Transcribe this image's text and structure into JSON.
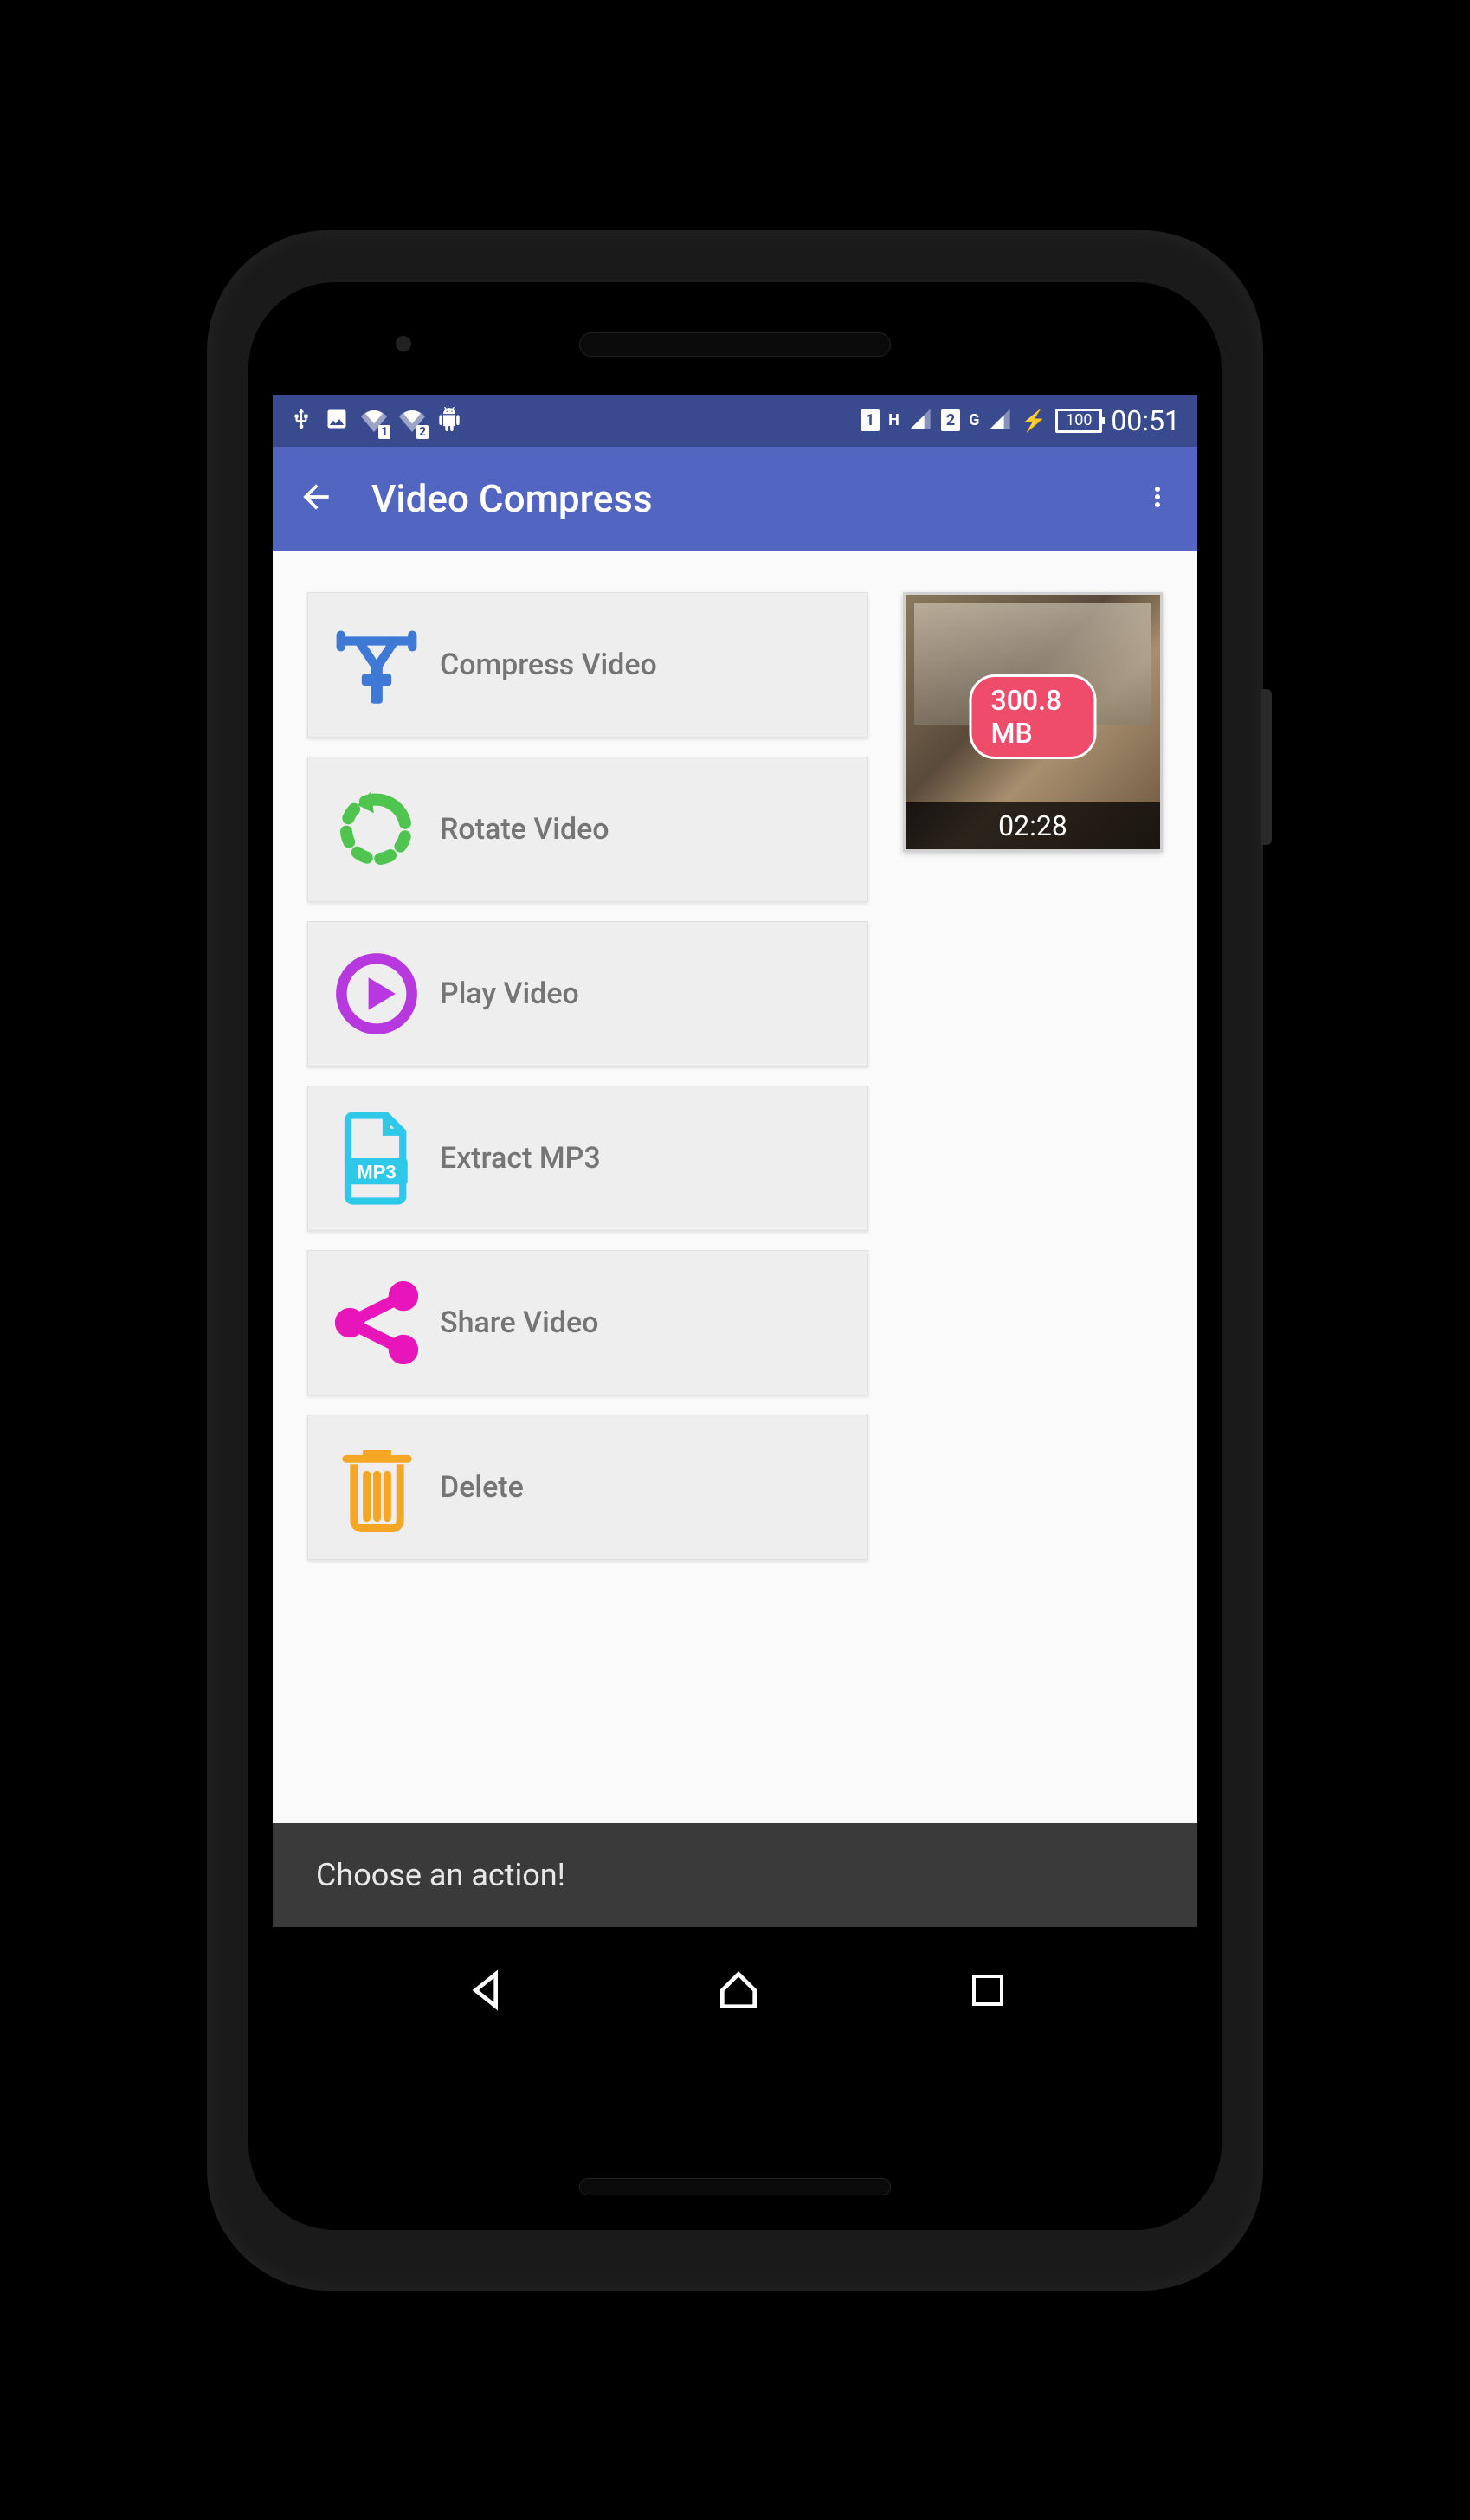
{
  "status": {
    "battery": "100",
    "time": "00:51",
    "sim1_label": "1",
    "sim1_net": "H",
    "sim2_label": "2",
    "sim2_net": "G"
  },
  "appbar": {
    "title": "Video Compress"
  },
  "actions": [
    {
      "label": "Compress Video"
    },
    {
      "label": "Rotate Video"
    },
    {
      "label": "Play Video"
    },
    {
      "label": "Extract MP3"
    },
    {
      "label": "Share Video"
    },
    {
      "label": "Delete"
    }
  ],
  "thumbnail": {
    "size_badge": "300.8 MB",
    "duration": "02:28"
  },
  "footer": {
    "hint": "Choose an action!"
  }
}
